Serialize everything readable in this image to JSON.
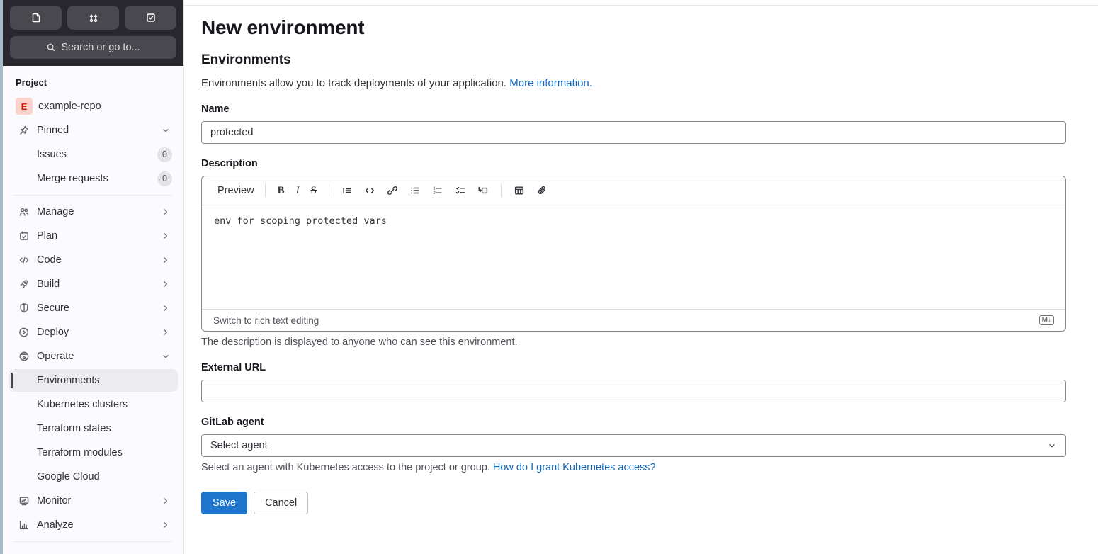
{
  "colors": {
    "sidebar_header_bg": "#28272d",
    "sidebar_bg": "#fbfafd",
    "active_item_bg": "#ececef",
    "accent_blue": "#1f75cb",
    "link_blue": "#1068bf",
    "avatar_bg": "#fdd4cd",
    "avatar_text": "#c91c00"
  },
  "sidebar": {
    "header_icons": [
      "issues-icon",
      "merge-request-icon",
      "todo-icon"
    ],
    "search_label": "Search or go to...",
    "section_label": "Project",
    "project": {
      "avatar_letter": "E",
      "name": "example-repo"
    },
    "pinned": {
      "label": "Pinned",
      "icon": "pin-icon",
      "state": "expanded"
    },
    "pinned_items": [
      {
        "label": "Issues",
        "badge": "0"
      },
      {
        "label": "Merge requests",
        "badge": "0"
      }
    ],
    "nav_items": [
      {
        "label": "Manage",
        "icon": "users-icon",
        "chevron": "right"
      },
      {
        "label": "Plan",
        "icon": "calendar-icon",
        "chevron": "right"
      },
      {
        "label": "Code",
        "icon": "code-icon",
        "chevron": "right"
      },
      {
        "label": "Build",
        "icon": "rocket-icon",
        "chevron": "right"
      },
      {
        "label": "Secure",
        "icon": "shield-icon",
        "chevron": "right"
      },
      {
        "label": "Deploy",
        "icon": "deploy-icon",
        "chevron": "right"
      }
    ],
    "operate": {
      "label": "Operate",
      "icon": "globe-icon",
      "state": "expanded"
    },
    "operate_items": [
      {
        "label": "Environments",
        "active": true
      },
      {
        "label": "Kubernetes clusters",
        "active": false
      },
      {
        "label": "Terraform states",
        "active": false
      },
      {
        "label": "Terraform modules",
        "active": false
      },
      {
        "label": "Google Cloud",
        "active": false
      }
    ],
    "bottom_items": [
      {
        "label": "Monitor",
        "icon": "monitor-icon",
        "chevron": "right"
      },
      {
        "label": "Analyze",
        "icon": "chart-icon",
        "chevron": "right"
      }
    ]
  },
  "main": {
    "title": "New environment",
    "section_title": "Environments",
    "intro_text": "Environments allow you to track deployments of your application.",
    "intro_link": "More information.",
    "name_field": {
      "label": "Name",
      "value": "protected"
    },
    "description": {
      "label": "Description",
      "preview_label": "Preview",
      "toolbar_icons": [
        "bold",
        "italic",
        "strikethrough",
        "quote",
        "code",
        "link",
        "bulleted-list",
        "numbered-list",
        "task-list",
        "collapsible-section",
        "table",
        "attach-file"
      ],
      "content": "env for scoping protected vars",
      "switch_label": "Switch to rich text editing",
      "markdown_badge": "M↓",
      "help": "The description is displayed to anyone who can see this environment."
    },
    "external_url": {
      "label": "External URL",
      "value": ""
    },
    "agent": {
      "label": "GitLab agent",
      "value": "Select agent",
      "help": "Select an agent with Kubernetes access to the project or group.",
      "help_link": "How do I grant Kubernetes access?"
    },
    "buttons": {
      "save": "Save",
      "cancel": "Cancel"
    }
  }
}
